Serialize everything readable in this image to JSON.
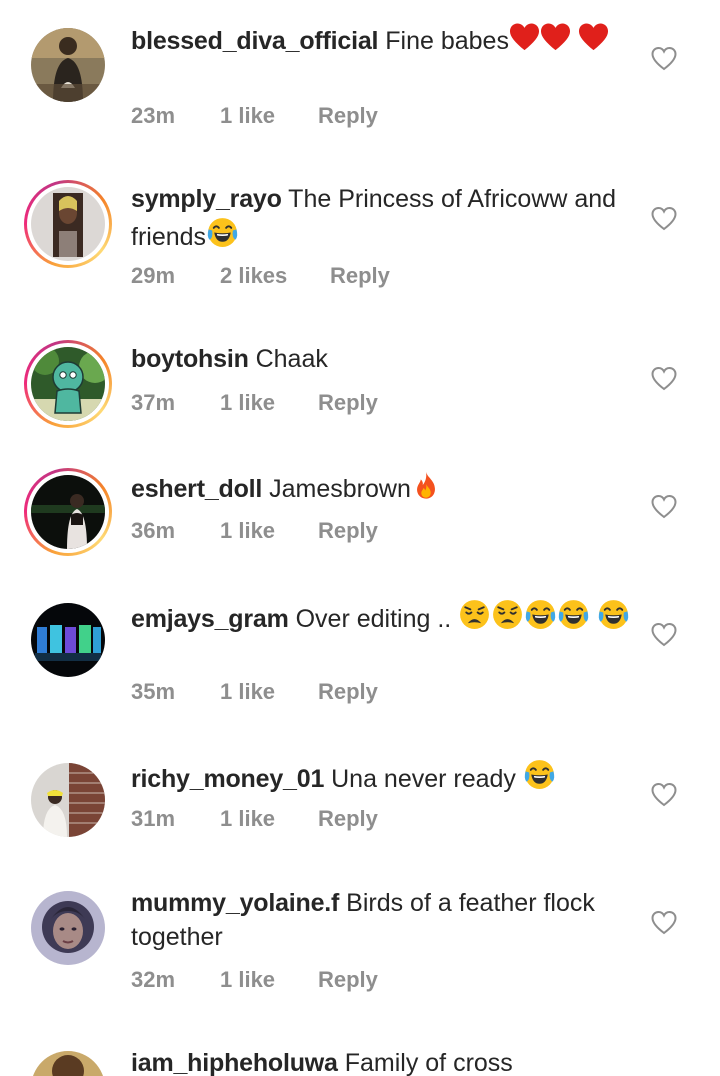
{
  "comments": [
    {
      "username": "blessed_diva_official",
      "text": "Fine babes",
      "emoji": [
        "red-heart",
        "red-heart",
        "red-heart"
      ],
      "time": "23m",
      "likes": "1 like",
      "reply": "Reply"
    },
    {
      "username": "symply_rayo",
      "text": "The Princess of Africoww and friends",
      "emoji": [
        "joy"
      ],
      "time": "29m",
      "likes": "2 likes",
      "reply": "Reply"
    },
    {
      "username": "boytohsin",
      "text": "Chaak",
      "emoji": [],
      "time": "37m",
      "likes": "1 like",
      "reply": "Reply"
    },
    {
      "username": "eshert_doll",
      "text": "Jamesbrown",
      "emoji": [
        "fire"
      ],
      "time": "36m",
      "likes": "1 like",
      "reply": "Reply"
    },
    {
      "username": "emjays_gram",
      "text": "Over editing ..",
      "emoji": [
        "weary",
        "weary",
        "joy",
        "joy",
        "joy"
      ],
      "time": "35m",
      "likes": "1 like",
      "reply": "Reply"
    },
    {
      "username": "richy_money_01",
      "text": "Una never ready",
      "emoji": [
        "joy"
      ],
      "time": "31m",
      "likes": "1 like",
      "reply": "Reply"
    },
    {
      "username": "mummy_yolaine.f",
      "text": "Birds of a feather flock together",
      "emoji": [],
      "time": "32m",
      "likes": "1 like",
      "reply": "Reply"
    },
    {
      "username": "iam_hipheholuwa",
      "text": "Family of cross"
    }
  ],
  "icons": {
    "like": "heart-outline-icon"
  },
  "colors": {
    "text": "#262626",
    "meta": "#8e8e8e",
    "story_ring_start": "#f9a13a",
    "story_ring_end": "#c13584"
  }
}
